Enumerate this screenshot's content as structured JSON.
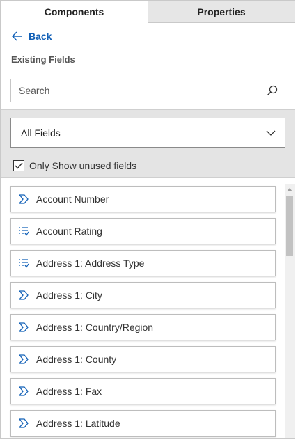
{
  "tabs": [
    {
      "label": "Components",
      "active": true
    },
    {
      "label": "Properties",
      "active": false
    }
  ],
  "back": {
    "label": "Back"
  },
  "section_title": "Existing Fields",
  "search": {
    "placeholder": "Search",
    "value": ""
  },
  "filter": {
    "selected": "All Fields"
  },
  "only_unused": {
    "label": "Only Show unused fields",
    "checked": true
  },
  "fields": [
    {
      "label": "Account Number",
      "icon": "text-field-icon"
    },
    {
      "label": "Account Rating",
      "icon": "option-set-icon"
    },
    {
      "label": "Address 1: Address Type",
      "icon": "option-set-icon"
    },
    {
      "label": "Address 1: City",
      "icon": "text-field-icon"
    },
    {
      "label": "Address 1: Country/Region",
      "icon": "text-field-icon"
    },
    {
      "label": "Address 1: County",
      "icon": "text-field-icon"
    },
    {
      "label": "Address 1: Fax",
      "icon": "text-field-icon"
    },
    {
      "label": "Address 1: Latitude",
      "icon": "text-field-icon"
    }
  ],
  "colors": {
    "accent": "#1160b7",
    "panel_gray": "#e4e4e4"
  }
}
